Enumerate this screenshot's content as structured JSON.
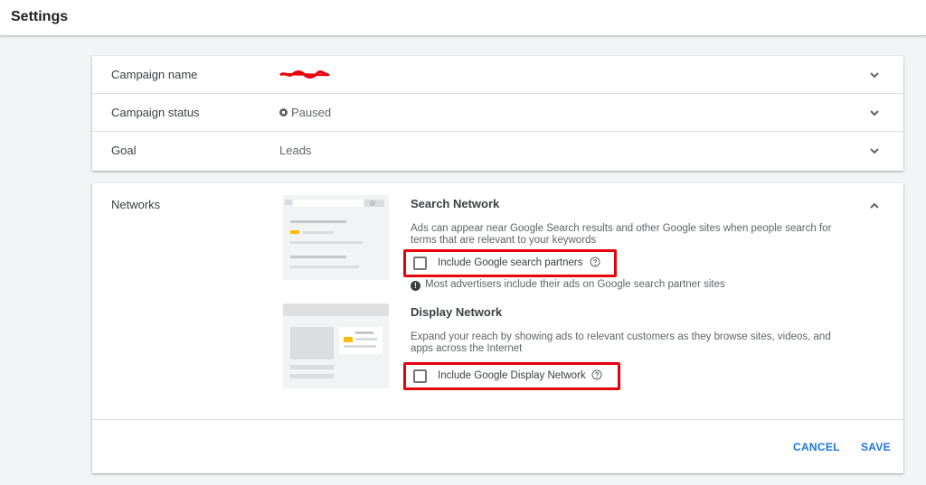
{
  "page": {
    "title": "Settings"
  },
  "summary": {
    "rows": [
      {
        "label": "Campaign name",
        "value": ""
      },
      {
        "label": "Campaign status",
        "value": "Paused"
      },
      {
        "label": "Goal",
        "value": "Leads"
      }
    ]
  },
  "networks": {
    "label": "Networks",
    "search": {
      "title": "Search Network",
      "description": "Ads can appear near Google Search results and other Google sites when people search for terms that are relevant to your keywords",
      "checkbox_label": "Include Google search partners",
      "checked": false,
      "info": "Most advertisers include their ads on Google search partner sites"
    },
    "display": {
      "title": "Display Network",
      "description": "Expand your reach by showing ads to relevant customers as they browse sites, videos, and apps across the Internet",
      "checkbox_label": "Include Google Display Network",
      "checked": false
    }
  },
  "actions": {
    "cancel": "CANCEL",
    "save": "SAVE"
  },
  "colors": {
    "accent": "#1a73e8",
    "highlight": "#e8000b",
    "ad_marker": "#fbbc04"
  },
  "icons": {
    "expand": "chevron-down-icon",
    "collapse": "chevron-up-icon",
    "help": "help-circle-icon",
    "info": "info-icon",
    "status": "paused-status-icon"
  }
}
